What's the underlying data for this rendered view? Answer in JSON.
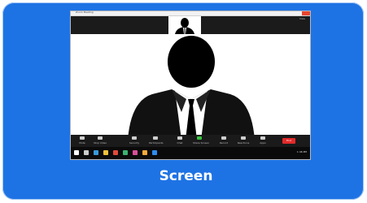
{
  "window": {
    "title": "Zoom Meeting"
  },
  "top_strip": {
    "label": "View"
  },
  "controls": [
    {
      "label": "Mute"
    },
    {
      "label": "Stop Video"
    },
    {
      "label": "Security"
    },
    {
      "label": "Participants"
    },
    {
      "label": "Chat"
    },
    {
      "label": "Share Screen"
    },
    {
      "label": "Record"
    },
    {
      "label": "Reactions"
    },
    {
      "label": "Apps"
    }
  ],
  "end_button": {
    "label": "End"
  },
  "taskbar": {
    "clock": "1:46 PM"
  },
  "caption": "Screen",
  "colors": {
    "card": "#1e73e4",
    "share_green": "#35c23f",
    "end_red": "#e22a2a"
  }
}
